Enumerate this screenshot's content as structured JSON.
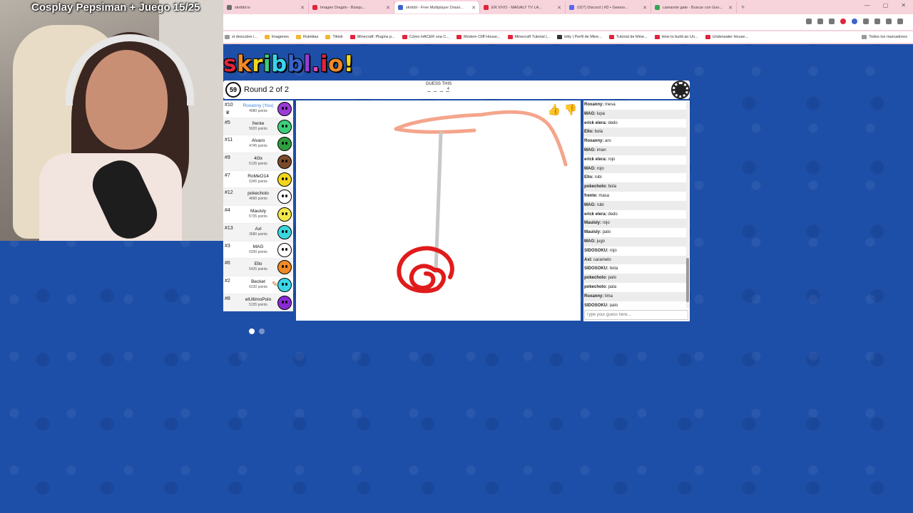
{
  "stream": {
    "title": "Cosplay Pepsiman + Juego 15/25"
  },
  "browser": {
    "tabs": [
      {
        "label": "skribbl.io",
        "color": "#6d6d6d"
      },
      {
        "label": "Imagen Dragón - Búsqu...",
        "color": "#e0253a"
      },
      {
        "label": "skribbl - Free Multiplayer Drawi...",
        "color": "#3a64c8",
        "active": true
      },
      {
        "label": "EN VIVO - MAGALY TV LA...",
        "color": "#e0253a"
      },
      {
        "label": "(027) Discord | #D • Gewoo...",
        "color": "#5865f2"
      },
      {
        "label": "camarote gate - Buscar con Goo...",
        "color": "#34a853"
      }
    ],
    "bookmarks": [
      {
        "label": "st descubre i...",
        "color": "#999999"
      },
      {
        "label": "Imagenes",
        "color": "#f2b632"
      },
      {
        "label": "Ruletitas",
        "color": "#f2b632"
      },
      {
        "label": "Tiktok",
        "color": "#f2b632"
      },
      {
        "label": "Minecraft: Plugins p...",
        "color": "#e0253a"
      },
      {
        "label": "Cómo HACER una C...",
        "color": "#e0253a"
      },
      {
        "label": "Modern Cliff House...",
        "color": "#e0253a"
      },
      {
        "label": "Minecraft Tutorial |...",
        "color": "#e0253a"
      },
      {
        "label": "kitty | Perfil de Mine...",
        "color": "#333333"
      },
      {
        "label": "Tutorial de Mine...",
        "color": "#e0253a"
      },
      {
        "label": "How to build an Un...",
        "color": "#e0253a"
      },
      {
        "label": "Underwater House...",
        "color": "#e0253a"
      }
    ],
    "bookmarks_all": "Todos los marcadores"
  },
  "game": {
    "logo": "skribbl.io!",
    "timer": "59",
    "round": "Round 2 of 2",
    "word_hint_label": "GUESS THIS",
    "word_blanks": "_ _ _ _",
    "word_length": "4",
    "players": [
      {
        "rank": "#10",
        "name": "Roxanny (You)",
        "points": "4980 points",
        "you": true,
        "crown": true,
        "color": "#9b3ad6"
      },
      {
        "rank": "#5",
        "name": "frente",
        "points": "5620 points",
        "color": "#3ccf7a"
      },
      {
        "rank": "#11",
        "name": "Alvaro",
        "points": "4745 points",
        "color": "#2e9e3e"
      },
      {
        "rank": "#9",
        "name": "4l3x",
        "points": "5135 points",
        "color": "#7a4a2a"
      },
      {
        "rank": "#7",
        "name": "RoMeO14",
        "points": "5345 points",
        "color": "#f2d61c"
      },
      {
        "rank": "#12",
        "name": "pokecholo",
        "points": "4690 points",
        "color": "#ffffff"
      },
      {
        "rank": "#4",
        "name": "Mauisly",
        "points": "5735 points",
        "color": "#f2e84a"
      },
      {
        "rank": "#13",
        "name": "Axl",
        "points": "3680 points",
        "color": "#3ad6e0"
      },
      {
        "rank": "#3",
        "name": "MAG",
        "points": "6200 points",
        "color": "#ffffff"
      },
      {
        "rank": "#6",
        "name": "Ello",
        "points": "5425 points",
        "color": "#f08a24"
      },
      {
        "rank": "#2",
        "name": "Becket",
        "points": "6230 points",
        "color": "#3ad6e8",
        "drawing": true
      },
      {
        "rank": "#8",
        "name": "elUltimoPolo",
        "points": "5155 points",
        "color": "#8a2ad6"
      }
    ],
    "chat": [
      {
        "name": "Roxanny:",
        "text": "mesa"
      },
      {
        "name": "MAG:",
        "text": "lupa"
      },
      {
        "name": "erick elera:",
        "text": "dedo"
      },
      {
        "name": "Ello:",
        "text": "bola"
      },
      {
        "name": "Roxanny:",
        "text": "aro"
      },
      {
        "name": "MAG:",
        "text": "iman"
      },
      {
        "name": "erick elera:",
        "text": "rojo"
      },
      {
        "name": "MAG:",
        "text": "rojo"
      },
      {
        "name": "Ello:",
        "text": "rubi"
      },
      {
        "name": "pokecholo:",
        "text": "bola"
      },
      {
        "name": "frente:",
        "text": "masa"
      },
      {
        "name": "MAG:",
        "text": "rubi"
      },
      {
        "name": "erick elera:",
        "text": "dedo"
      },
      {
        "name": "Mauisly:",
        "text": "rojo"
      },
      {
        "name": "Mauisly:",
        "text": "palo"
      },
      {
        "name": "MAG:",
        "text": "jugo"
      },
      {
        "name": "SIDOSOKU:",
        "text": "rojo"
      },
      {
        "name": "Axl:",
        "text": "caramelo"
      },
      {
        "name": "SIDOSOKU:",
        "text": "bola"
      },
      {
        "name": "pokecholo:",
        "text": "palo"
      },
      {
        "name": "pokecholo:",
        "text": "pala"
      },
      {
        "name": "Roxanny:",
        "text": "lima"
      },
      {
        "name": "SIDOSOKU:",
        "text": "palo"
      }
    ],
    "guess_placeholder": "Type your guess here..."
  }
}
